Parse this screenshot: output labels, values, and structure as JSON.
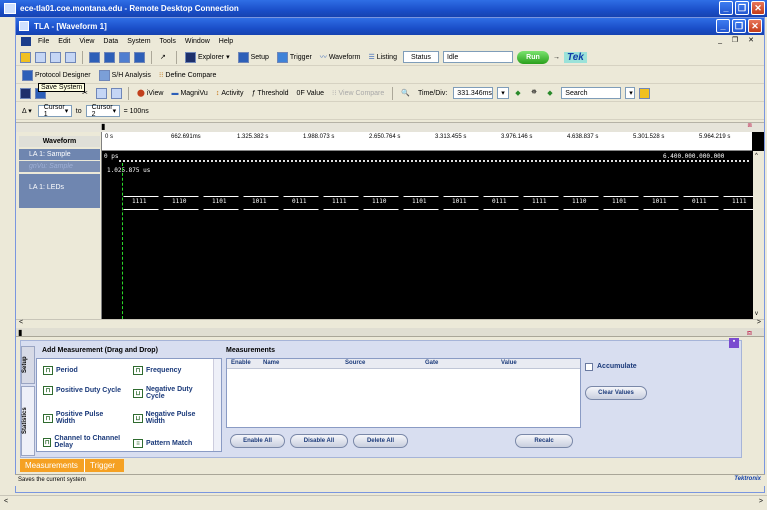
{
  "outer_window": {
    "title": "ece-tla01.coe.montana.edu - Remote Desktop Connection"
  },
  "app": {
    "title": "TLA - [Waveform 1]"
  },
  "menu": [
    "File",
    "Edit",
    "View",
    "Data",
    "System",
    "Tools",
    "Window",
    "Help"
  ],
  "toolbar1": {
    "explorer": "Explorer",
    "setup": "Setup",
    "trigger": "Trigger",
    "waveform": "Waveform",
    "listing": "Listing",
    "status_btn": "Status",
    "status_value": "Idle",
    "run": "Run",
    "tek": "Tek"
  },
  "toolbar2": {
    "protocol_designer": "Protocol Designer",
    "sh_analysis": "S/H Analysis",
    "define_compare": "Define Compare"
  },
  "toolbar3": {
    "tooltip": "Save System",
    "iview": "iView",
    "magnivu": "MagniVu",
    "activity": "Activity",
    "threshold": "Threshold",
    "value": "0F Value",
    "view_compare": "View Compare",
    "time_div_label": "Time/Div:",
    "time_div_value": "331.346ms",
    "search": "Search"
  },
  "toolbar4": {
    "cursor1": "Cursor 1",
    "to": "to",
    "cursor2": "Cursor 2",
    "delta": "= 100ns"
  },
  "waveform": {
    "col_header": "Waveform",
    "rows": [
      "LA 1: Sample",
      "gnVu: Sample",
      "LA 1: LEDs"
    ],
    "ruler": [
      "0 s",
      "662.691ms",
      "1.325.382 s",
      "1.988.073 s",
      "2.650.764 s",
      "3.313.455 s",
      "3.976.146 s",
      "4.638.837 s",
      "5.301.528 s",
      "5.964.219 s"
    ],
    "sample_start": "0 ps",
    "sample_end": "6.400.000.000.000",
    "sample_row2": "1.025.875 us",
    "bus_values": [
      "1111",
      "1110",
      "1101",
      "1011",
      "0111",
      "1111",
      "1110",
      "1101",
      "1011",
      "0111",
      "1111",
      "1110",
      "1101",
      "1011",
      "0111",
      "1111"
    ]
  },
  "panel": {
    "tabs": [
      "Setup",
      "Statistics"
    ],
    "add_title": "Add Measurement (Drag and Drop)",
    "items": [
      "Period",
      "Frequency",
      "Positive Duty Cycle",
      "Negative Duty Cycle",
      "Positive Pulse Width",
      "Negative Pulse Width",
      "Channel to Channel Delay",
      "Pattern Match"
    ],
    "meas_title": "Measurements",
    "columns": [
      "Enable",
      "Name",
      "Source",
      "Gate",
      "Value"
    ],
    "enable_all": "Enable All",
    "disable_all": "Disable All",
    "delete_all": "Delete All",
    "recalc": "Recalc",
    "accumulate": "Accumulate",
    "clear_values": "Clear Values"
  },
  "bottom_tabs": [
    "Measurements",
    "Trigger"
  ],
  "status_text": "Saves the current system",
  "status_brand": "Tektronix"
}
